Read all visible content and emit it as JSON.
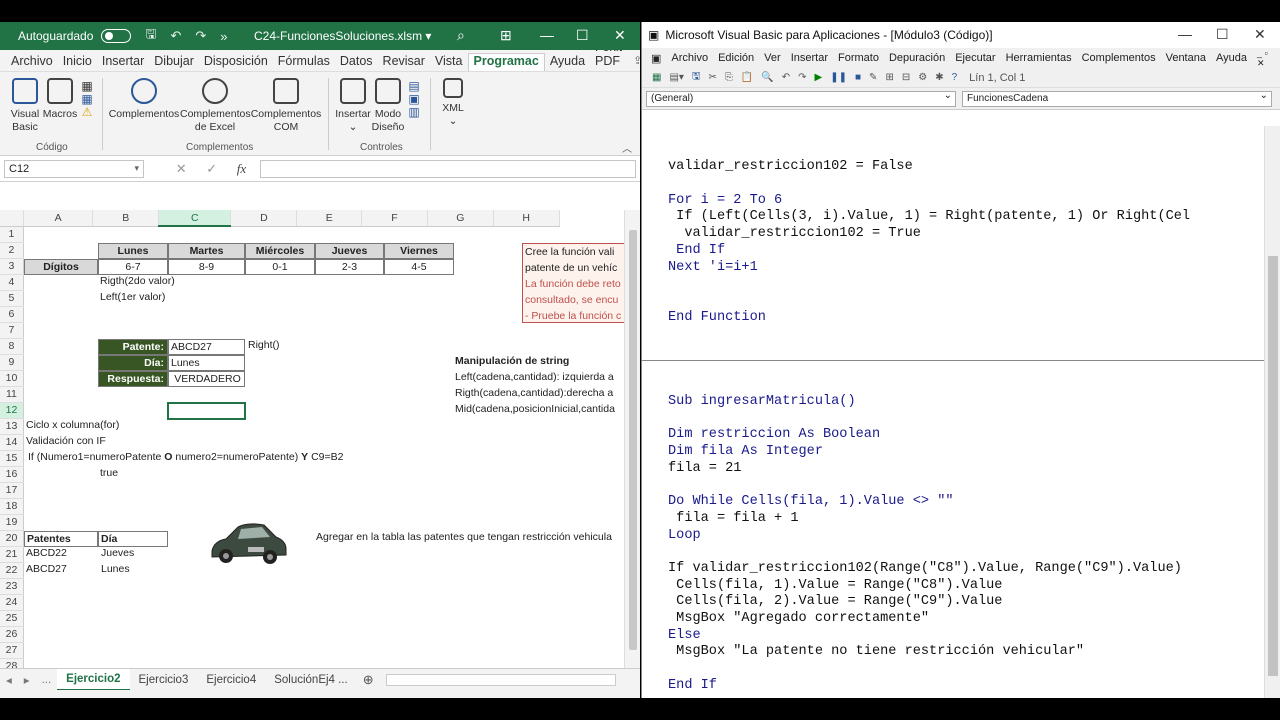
{
  "excel": {
    "autosave_label": "Autoguardado",
    "file_name": "C24-FuncionesSoluciones.xlsm",
    "menu": [
      "Archivo",
      "Inicio",
      "Insertar",
      "Dibujar",
      "Disposición",
      "Fórmulas",
      "Datos",
      "Revisar",
      "Vista",
      "Programac",
      "Ayuda",
      "Foxit PDF"
    ],
    "ribbon": {
      "visual_basic": "Visual Basic",
      "macros": "Macros",
      "complementos": "Complementos",
      "complementos_excel": "Complementos de Excel",
      "complementos_com": "Complementos COM",
      "insertar": "Insertar",
      "modo_diseno": "Modo Diseño",
      "xml": "XML",
      "group_codigo": "Código",
      "group_complementos": "Complementos",
      "group_controles": "Controles"
    },
    "name_box": "C12",
    "columns": [
      "A",
      "B",
      "C",
      "D",
      "E",
      "F",
      "G",
      "H"
    ],
    "rows": [
      "1",
      "2",
      "3",
      "4",
      "5",
      "6",
      "7",
      "8",
      "9",
      "10",
      "11",
      "12",
      "13",
      "14",
      "15",
      "16",
      "17",
      "18",
      "19",
      "20",
      "21",
      "22",
      "23",
      "24",
      "25",
      "26",
      "27",
      "28",
      "29"
    ],
    "days": [
      "Lunes",
      "Martes",
      "Miércoles",
      "Jueves",
      "Viernes"
    ],
    "digits_label": "Dígitos",
    "digits": [
      "6-7",
      "8-9",
      "0-1",
      "2-3",
      "4-5"
    ],
    "note_b4": "Rigth(2do valor)",
    "note_b5": "Left(1er valor)",
    "patente_label": "Patente:",
    "patente_value": "ABCD27",
    "right_note": "Right()",
    "dia_label": "Día:",
    "dia_value": "Lunes",
    "respuesta_label": "Respuesta:",
    "respuesta_value": "VERDADERO",
    "ciclo": "Ciclo x columna(for)",
    "validacion": "Validación con IF",
    "if_parts": [
      "If (Numero1=numeroPatente ",
      "O",
      " numero2=numeroPatente) ",
      "Y",
      " C9=B2"
    ],
    "true_text": "true",
    "table_headers": [
      "Patentes",
      "Día"
    ],
    "table_rows": [
      [
        "ABCD22",
        "Jueves"
      ],
      [
        "ABCD27",
        "Lunes"
      ]
    ],
    "agregar_text": "Agregar en la tabla las patentes que tengan restricción vehicula",
    "box_lines": [
      "Cree la función vali",
      "patente de un vehíc",
      "La función debe reto",
      "consultado, se encu",
      "- Pruebe la función c"
    ],
    "manip_title": "Manipulación de string",
    "manip_lines": [
      "Left(cadena,cantidad): izquierda a",
      "Rigth(cadena,cantidad):derecha a",
      "Mid(cadena,posicionInicial,cantida"
    ],
    "sheet_tabs": [
      "Ejercicio2",
      "Ejercicio3",
      "Ejercicio4",
      "SoluciónEj4 ..."
    ],
    "colors": {
      "brand": "#217346",
      "dark_header": "#375623",
      "note_border": "#c0504d"
    }
  },
  "vba": {
    "title": "Microsoft Visual Basic para Aplicaciones - [Módulo3 (Código)]",
    "menu": [
      "Archivo",
      "Edición",
      "Ver",
      "Insertar",
      "Formato",
      "Depuración",
      "Ejecutar",
      "Herramientas",
      "Complementos",
      "Ventana",
      "Ayuda"
    ],
    "position": "Lín 1, Col 1",
    "combo_left": "(General)",
    "combo_right": "FuncionesCadena",
    "code_block1": [
      "validar_restriccion102 = False",
      "",
      "For i = 2 To 6",
      " If (Left(Cells(3, i).Value, 1) = Right(patente, 1) Or Right(Cel",
      "  validar_restriccion102 = True",
      " End If",
      "Next 'i=i+1",
      "",
      "",
      "End Function"
    ],
    "code_block2": [
      "Sub ingresarMatricula()",
      "",
      "Dim restriccion As Boolean",
      "Dim fila As Integer",
      "fila = 21",
      "",
      "Do While Cells(fila, 1).Value <> \"\"",
      " fila = fila + 1",
      "Loop",
      "",
      "If validar_restriccion102(Range(\"C8\").Value, Range(\"C9\").Value)",
      " Cells(fila, 1).Value = Range(\"C8\").Value",
      " Cells(fila, 2).Value = Range(\"C9\").Value",
      " MsgBox \"Agregado correctamente\"",
      "Else",
      " MsgBox \"La patente no tiene restricción vehicular\"",
      "",
      "End If"
    ]
  }
}
